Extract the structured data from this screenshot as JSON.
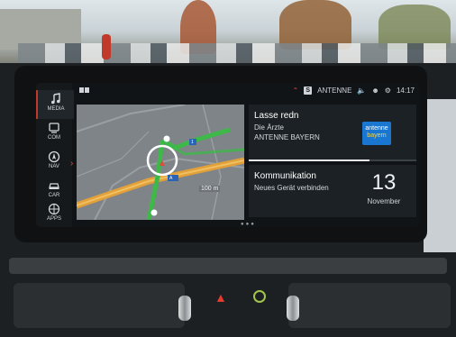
{
  "sidebar": {
    "items": [
      {
        "label": "MEDIA",
        "icon": "music-note-icon",
        "active": true
      },
      {
        "label": "COM",
        "icon": "phone-icon",
        "active": false
      },
      {
        "label": "NAV",
        "icon": "navigation-icon",
        "active": false
      },
      {
        "label": "CAR",
        "icon": "car-icon",
        "active": false
      },
      {
        "label": "APPS",
        "icon": "apps-globe-icon",
        "active": false
      }
    ]
  },
  "status_bar": {
    "source": "ANTENNE",
    "time": "14:17",
    "source_icon_letter": "S"
  },
  "map": {
    "scale_label": "100 m",
    "road_label_1": "A",
    "road_label_2": "1"
  },
  "media_card": {
    "title": "Lasse redn",
    "artist": "Die Ärzte",
    "station": "ANTENNE BAYERN",
    "logo_line1": "antenne",
    "logo_line2": "bayern",
    "progress": 0.72
  },
  "com_card": {
    "title": "Kommunikation",
    "subtitle": "Neues Gerät verbinden",
    "day": "13",
    "month": "November"
  },
  "colors": {
    "accent_red": "#e04a3a",
    "route_green": "#3fb84a",
    "highway_orange": "#e2a03a",
    "logo_blue": "#1977d2"
  }
}
